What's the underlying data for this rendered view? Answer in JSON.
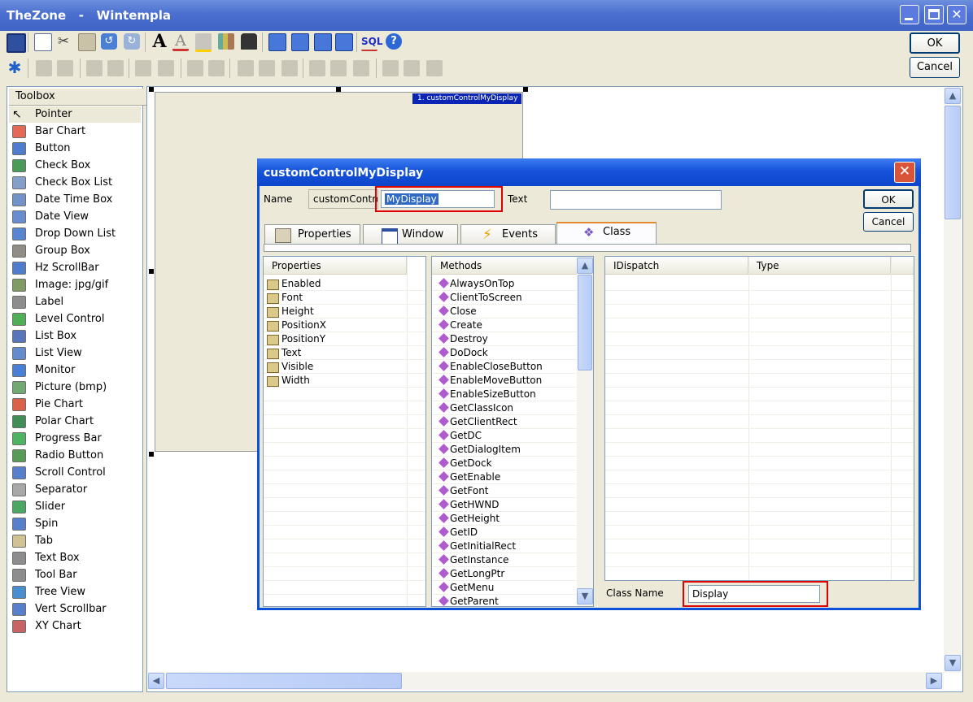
{
  "window": {
    "title": "TheZone   -   Wintempla",
    "ok_label": "OK",
    "cancel_label": "Cancel"
  },
  "toolbox": {
    "header": "Toolbox",
    "items": [
      {
        "label": "Pointer",
        "icon": "pointer-icon"
      },
      {
        "label": "Bar Chart",
        "icon": "bar-chart-icon"
      },
      {
        "label": "Button",
        "icon": "button-icon"
      },
      {
        "label": "Check Box",
        "icon": "check-box-icon"
      },
      {
        "label": "Check Box List",
        "icon": "check-box-list-icon"
      },
      {
        "label": "Date Time Box",
        "icon": "date-time-box-icon"
      },
      {
        "label": "Date View",
        "icon": "date-view-icon"
      },
      {
        "label": "Drop Down List",
        "icon": "drop-down-list-icon"
      },
      {
        "label": "Group Box",
        "icon": "group-box-icon"
      },
      {
        "label": "Hz ScrollBar",
        "icon": "hz-scrollbar-icon"
      },
      {
        "label": "Image: jpg/gif",
        "icon": "image-icon"
      },
      {
        "label": "Label",
        "icon": "label-icon"
      },
      {
        "label": "Level Control",
        "icon": "level-control-icon"
      },
      {
        "label": "List Box",
        "icon": "list-box-icon"
      },
      {
        "label": "List View",
        "icon": "list-view-icon"
      },
      {
        "label": "Monitor",
        "icon": "monitor-icon"
      },
      {
        "label": "Picture (bmp)",
        "icon": "picture-icon"
      },
      {
        "label": "Pie Chart",
        "icon": "pie-chart-icon"
      },
      {
        "label": "Polar Chart",
        "icon": "polar-chart-icon"
      },
      {
        "label": "Progress Bar",
        "icon": "progress-bar-icon"
      },
      {
        "label": "Radio Button",
        "icon": "radio-button-icon"
      },
      {
        "label": "Scroll Control",
        "icon": "scroll-control-icon"
      },
      {
        "label": "Separator",
        "icon": "separator-icon"
      },
      {
        "label": "Slider",
        "icon": "slider-icon"
      },
      {
        "label": "Spin",
        "icon": "spin-icon"
      },
      {
        "label": "Tab",
        "icon": "tab-icon"
      },
      {
        "label": "Text Box",
        "icon": "text-box-icon"
      },
      {
        "label": "Tool Bar",
        "icon": "tool-bar-icon"
      },
      {
        "label": "Tree View",
        "icon": "tree-view-icon"
      },
      {
        "label": "Vert Scrollbar",
        "icon": "vert-scrollbar-icon"
      },
      {
        "label": "XY Chart",
        "icon": "xy-chart-icon"
      }
    ]
  },
  "canvas": {
    "form_tag": "1. customControlMyDisplay"
  },
  "dialog": {
    "title": "customControlMyDisplay",
    "name_label": "Name",
    "name_prefix": "customContro",
    "name_value": "MyDisplay",
    "text_label": "Text",
    "text_value": "",
    "ok_label": "OK",
    "cancel_label": "Cancel",
    "tabs": [
      {
        "label": "Properties"
      },
      {
        "label": "Window"
      },
      {
        "label": "Events"
      },
      {
        "label": "Class"
      }
    ],
    "properties_header": "Properties",
    "properties": [
      "Enabled",
      "Font",
      "Height",
      "PositionX",
      "PositionY",
      "Text",
      "Visible",
      "Width"
    ],
    "methods_header": "Methods",
    "methods": [
      "AlwaysOnTop",
      "ClientToScreen",
      "Close",
      "Create",
      "Destroy",
      "DoDock",
      "EnableCloseButton",
      "EnableMoveButton",
      "EnableSizeButton",
      "GetClassIcon",
      "GetClientRect",
      "GetDC",
      "GetDialogItem",
      "GetDock",
      "GetEnable",
      "GetFont",
      "GetHWND",
      "GetHeight",
      "GetID",
      "GetInitialRect",
      "GetInstance",
      "GetLongPtr",
      "GetMenu",
      "GetParent"
    ],
    "idispatch_header": "IDispatch",
    "type_header": "Type",
    "class_name_label": "Class Name",
    "class_name_value": "Display"
  },
  "colors": {
    "titlebar": "#3f63c6",
    "dialog_title": "#1653da",
    "highlight_box": "#e00000",
    "selection": "#316ac5"
  }
}
